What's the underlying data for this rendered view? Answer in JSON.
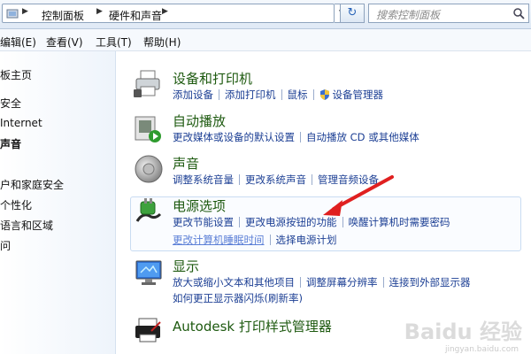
{
  "address_bar": {
    "crumbs": [
      "控制面板",
      "硬件和声音"
    ],
    "search_placeholder": "搜索控制面板"
  },
  "menu": [
    "编辑(E)",
    "查看(V)",
    "工具(T)",
    "帮助(H)"
  ],
  "sidebar": {
    "items": [
      {
        "label": "板主页"
      },
      {
        "label": "安全"
      },
      {
        "label": "Internet"
      },
      {
        "label": "声音"
      },
      {
        "label": "户和家庭安全"
      },
      {
        "label": "个性化"
      },
      {
        "label": "语言和区域"
      },
      {
        "label": "问"
      }
    ]
  },
  "categories": [
    {
      "title": "设备和打印机",
      "icon": "printer-icon",
      "links": [
        "添加设备",
        "添加打印机",
        "鼠标",
        "设备管理器"
      ]
    },
    {
      "title": "自动播放",
      "icon": "autoplay-icon",
      "links": [
        "更改媒体或设备的默认设置",
        "自动播放 CD 或其他媒体"
      ]
    },
    {
      "title": "声音",
      "icon": "speaker-icon",
      "links": [
        "调整系统音量",
        "更改系统声音",
        "管理音频设备"
      ]
    },
    {
      "title": "电源选项",
      "icon": "power-icon",
      "links": [
        "更改节能设置",
        "更改电源按钮的功能",
        "唤醒计算机时需要密码",
        "更改计算机睡眠时间",
        "选择电源计划"
      ]
    },
    {
      "title": "显示",
      "icon": "display-icon",
      "links": [
        "放大或缩小文本和其他项目",
        "调整屏幕分辨率",
        "连接到外部显示器",
        "如何更正显示器闪烁(刷新率)"
      ]
    },
    {
      "title": "Autodesk 打印样式管理器",
      "icon": "plotter-icon",
      "links": []
    }
  ],
  "watermark": {
    "text": "Baidu 经验",
    "sub": "jingyan.baidu.com"
  },
  "colors": {
    "title_green": "#1e5a10",
    "link_blue": "#1c3f94",
    "arrow_red": "#e02020"
  }
}
